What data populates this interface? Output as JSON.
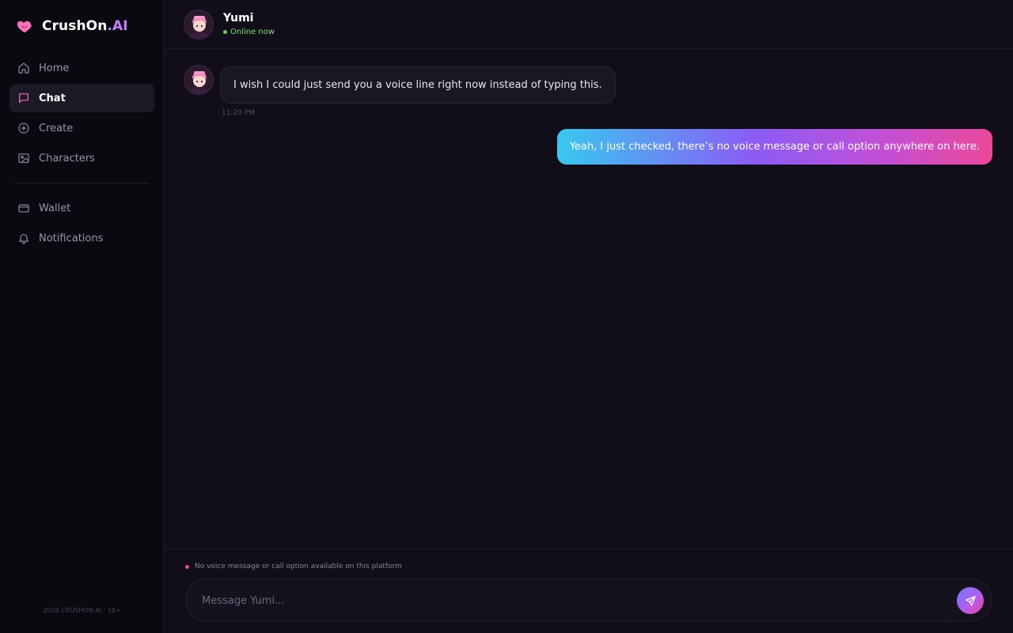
{
  "brand": {
    "name_main": "CrushOn",
    "name_accent": ".AI",
    "icon": "heart-icon"
  },
  "sidebar": {
    "items": [
      {
        "label": "Home",
        "icon": "home-icon"
      },
      {
        "label": "Chat",
        "icon": "chat-icon",
        "active": true
      },
      {
        "label": "Create",
        "icon": "plus-square-icon"
      },
      {
        "label": "Characters",
        "icon": "image-icon"
      },
      {
        "label": "Wallet",
        "icon": "wallet-icon"
      },
      {
        "label": "Notifications",
        "icon": "bell-icon"
      }
    ],
    "footer": "2026 CRUSHON.AI · 18+"
  },
  "header": {
    "name": "Yumi",
    "status": "Online now"
  },
  "messages": [
    {
      "from": "bot",
      "text": "I wish I could just send you a voice line right now instead of typing this.",
      "time": "11:20 PM"
    },
    {
      "from": "user",
      "text": "Yeah, I just checked, there’s no voice message or call option anywhere on here."
    }
  ],
  "composer": {
    "notice": "No voice message or call option available on this platform",
    "placeholder": "Message Yumi...",
    "send_icon": "send-icon"
  },
  "colors": {
    "accent": "#c77dff",
    "online": "#5fd94a",
    "notice_dot": "#ec4899"
  }
}
